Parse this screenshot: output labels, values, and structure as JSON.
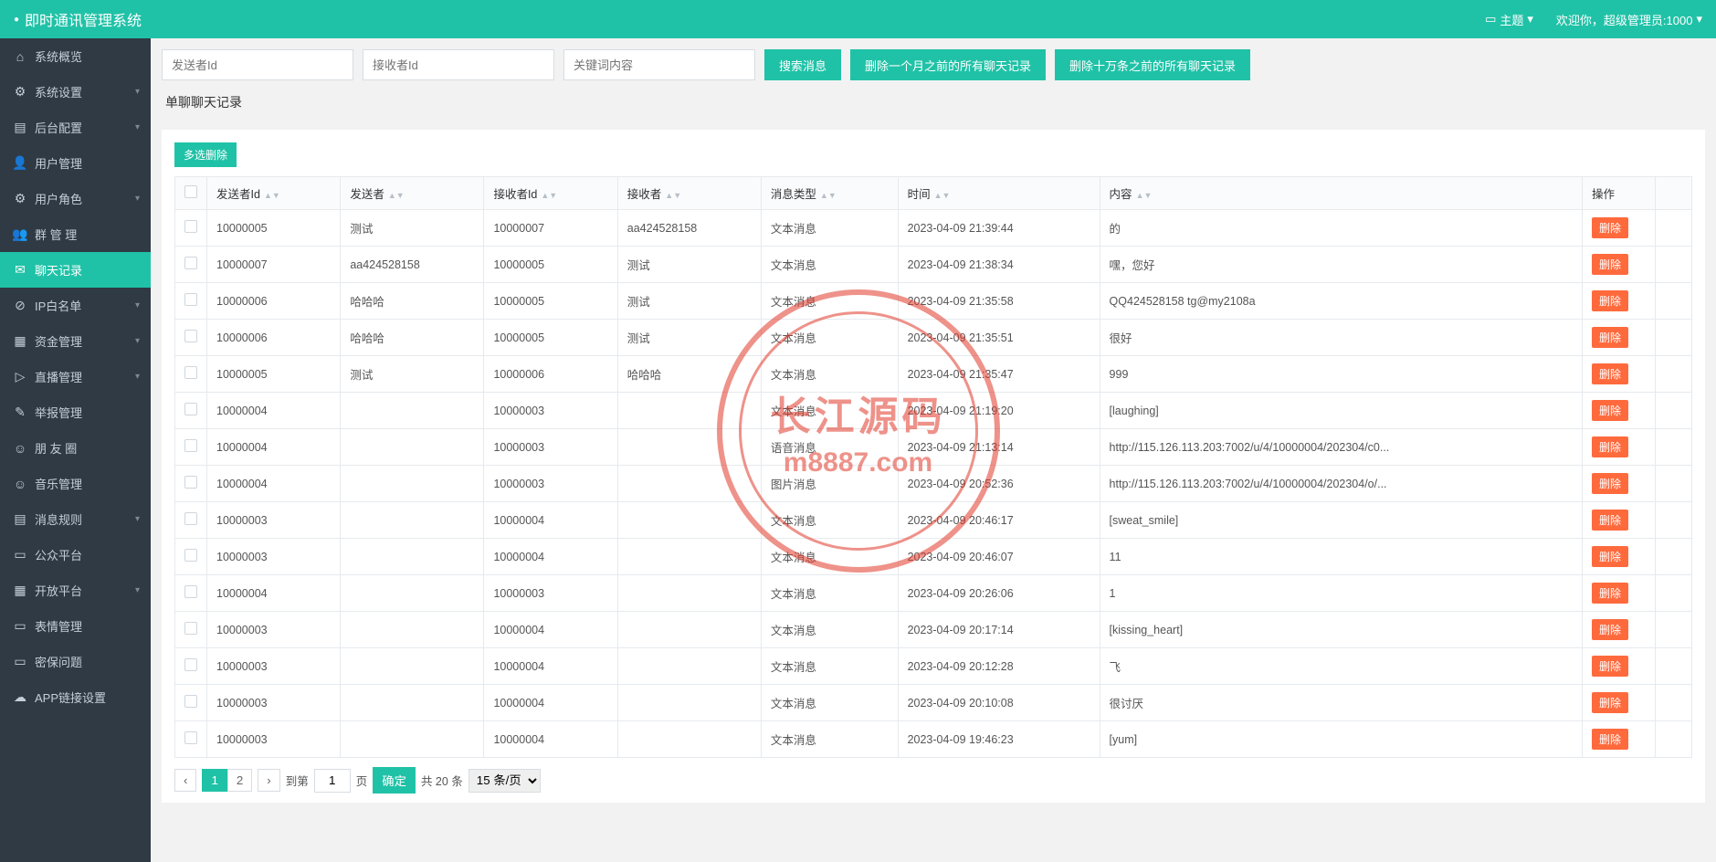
{
  "header": {
    "brand": "即时通讯管理系统",
    "theme_label": "主题",
    "welcome": "欢迎你，超级管理员:1000"
  },
  "sidebar": {
    "items": [
      {
        "icon": "⌂",
        "label": "系统概览",
        "expandable": false
      },
      {
        "icon": "⚙",
        "label": "系统设置",
        "expandable": true
      },
      {
        "icon": "▤",
        "label": "后台配置",
        "expandable": true
      },
      {
        "icon": "👤",
        "label": "用户管理",
        "expandable": false
      },
      {
        "icon": "⚙",
        "label": "用户角色",
        "expandable": true
      },
      {
        "icon": "👥",
        "label": "群 管 理",
        "expandable": false
      },
      {
        "icon": "✉",
        "label": "聊天记录",
        "expandable": false,
        "active": true
      },
      {
        "icon": "⊘",
        "label": "IP白名单",
        "expandable": true
      },
      {
        "icon": "▦",
        "label": "资金管理",
        "expandable": true
      },
      {
        "icon": "▷",
        "label": "直播管理",
        "expandable": true
      },
      {
        "icon": "✎",
        "label": "举报管理",
        "expandable": false
      },
      {
        "icon": "☺",
        "label": "朋 友 圈",
        "expandable": false
      },
      {
        "icon": "☺",
        "label": "音乐管理",
        "expandable": false
      },
      {
        "icon": "▤",
        "label": "消息规则",
        "expandable": true
      },
      {
        "icon": "▭",
        "label": "公众平台",
        "expandable": false
      },
      {
        "icon": "▦",
        "label": "开放平台",
        "expandable": true
      },
      {
        "icon": "▭",
        "label": "表情管理",
        "expandable": false
      },
      {
        "icon": "▭",
        "label": "密保问题",
        "expandable": false
      },
      {
        "icon": "☁",
        "label": "APP链接设置",
        "expandable": false
      }
    ]
  },
  "toolbar": {
    "sender_placeholder": "发送者Id",
    "receiver_placeholder": "接收者Id",
    "keyword_placeholder": "关键词内容",
    "search_btn": "搜索消息",
    "del_month_btn": "删除一个月之前的所有聊天记录",
    "del_100k_btn": "删除十万条之前的所有聊天记录"
  },
  "section_title": "单聊聊天记录",
  "panel": {
    "multi_delete": "多选删除",
    "columns": {
      "sender_id": "发送者Id",
      "sender": "发送者",
      "receiver_id": "接收者Id",
      "receiver": "接收者",
      "msg_type": "消息类型",
      "time": "时间",
      "content": "内容",
      "op": "操作"
    },
    "delete_label": "删除",
    "rows": [
      {
        "sid": "10000005",
        "sn": "测试",
        "rid": "10000007",
        "rn": "aa424528158",
        "type": "文本消息",
        "time": "2023-04-09 21:39:44",
        "content": "的"
      },
      {
        "sid": "10000007",
        "sn": "aa424528158",
        "rid": "10000005",
        "rn": "测试",
        "type": "文本消息",
        "time": "2023-04-09 21:38:34",
        "content": "嘿，您好"
      },
      {
        "sid": "10000006",
        "sn": "哈哈哈",
        "rid": "10000005",
        "rn": "测试",
        "type": "文本消息",
        "time": "2023-04-09 21:35:58",
        "content": "QQ424528158 tg@my2108a"
      },
      {
        "sid": "10000006",
        "sn": "哈哈哈",
        "rid": "10000005",
        "rn": "测试",
        "type": "文本消息",
        "time": "2023-04-09 21:35:51",
        "content": "很好"
      },
      {
        "sid": "10000005",
        "sn": "测试",
        "rid": "10000006",
        "rn": "哈哈哈",
        "type": "文本消息",
        "time": "2023-04-09 21:35:47",
        "content": "999"
      },
      {
        "sid": "10000004",
        "sn": "",
        "rid": "10000003",
        "rn": "",
        "type": "文本消息",
        "time": "2023-04-09 21:19:20",
        "content": "[laughing]"
      },
      {
        "sid": "10000004",
        "sn": "",
        "rid": "10000003",
        "rn": "",
        "type": "语音消息",
        "time": "2023-04-09 21:13:14",
        "content": "http://115.126.113.203:7002/u/4/10000004/202304/c0..."
      },
      {
        "sid": "10000004",
        "sn": "",
        "rid": "10000003",
        "rn": "",
        "type": "图片消息",
        "time": "2023-04-09 20:52:36",
        "content": "http://115.126.113.203:7002/u/4/10000004/202304/o/..."
      },
      {
        "sid": "10000003",
        "sn": "",
        "rid": "10000004",
        "rn": "",
        "type": "文本消息",
        "time": "2023-04-09 20:46:17",
        "content": "[sweat_smile]"
      },
      {
        "sid": "10000003",
        "sn": "",
        "rid": "10000004",
        "rn": "",
        "type": "文本消息",
        "time": "2023-04-09 20:46:07",
        "content": "11"
      },
      {
        "sid": "10000004",
        "sn": "",
        "rid": "10000003",
        "rn": "",
        "type": "文本消息",
        "time": "2023-04-09 20:26:06",
        "content": "1"
      },
      {
        "sid": "10000003",
        "sn": "",
        "rid": "10000004",
        "rn": "",
        "type": "文本消息",
        "time": "2023-04-09 20:17:14",
        "content": "[kissing_heart]"
      },
      {
        "sid": "10000003",
        "sn": "",
        "rid": "10000004",
        "rn": "",
        "type": "文本消息",
        "time": "2023-04-09 20:12:28",
        "content": "飞"
      },
      {
        "sid": "10000003",
        "sn": "",
        "rid": "10000004",
        "rn": "",
        "type": "文本消息",
        "time": "2023-04-09 20:10:08",
        "content": "很讨厌"
      },
      {
        "sid": "10000003",
        "sn": "",
        "rid": "10000004",
        "rn": "",
        "type": "文本消息",
        "time": "2023-04-09 19:46:23",
        "content": "[yum]"
      }
    ]
  },
  "pager": {
    "goto": "到第",
    "page_unit": "页",
    "confirm": "确定",
    "total": "共 20 条",
    "page_size": "15 条/页",
    "current_page": "1",
    "pages": [
      "1",
      "2"
    ]
  },
  "watermark": {
    "line1": "长江源码",
    "line2": "m8887.com"
  }
}
